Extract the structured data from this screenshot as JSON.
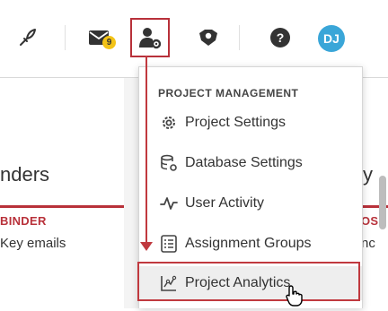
{
  "header": {
    "mail_badge": "9",
    "avatar_initials": "DJ",
    "icons": [
      "quill-icon",
      "mail-icon",
      "user-gear-icon",
      "shield-icon",
      "help-icon"
    ]
  },
  "background": {
    "title_left": "nders",
    "title_right": "y",
    "red_label_left": "BINDER",
    "red_label_right": "OS",
    "text_left": "Key emails",
    "text_right": "nc"
  },
  "menu": {
    "header": "PROJECT MANAGEMENT",
    "items": [
      {
        "label": "Project Settings",
        "icon": "gear-icon"
      },
      {
        "label": "Database Settings",
        "icon": "database-gear-icon"
      },
      {
        "label": "User Activity",
        "icon": "activity-icon"
      },
      {
        "label": "Assignment Groups",
        "icon": "list-icon"
      },
      {
        "label": "Project Analytics",
        "icon": "analytics-icon"
      }
    ],
    "highlighted_item": "Project Analytics"
  },
  "colors": {
    "accent": "#b8313a",
    "avatar": "#3aa6d8",
    "badge": "#f3c316"
  }
}
